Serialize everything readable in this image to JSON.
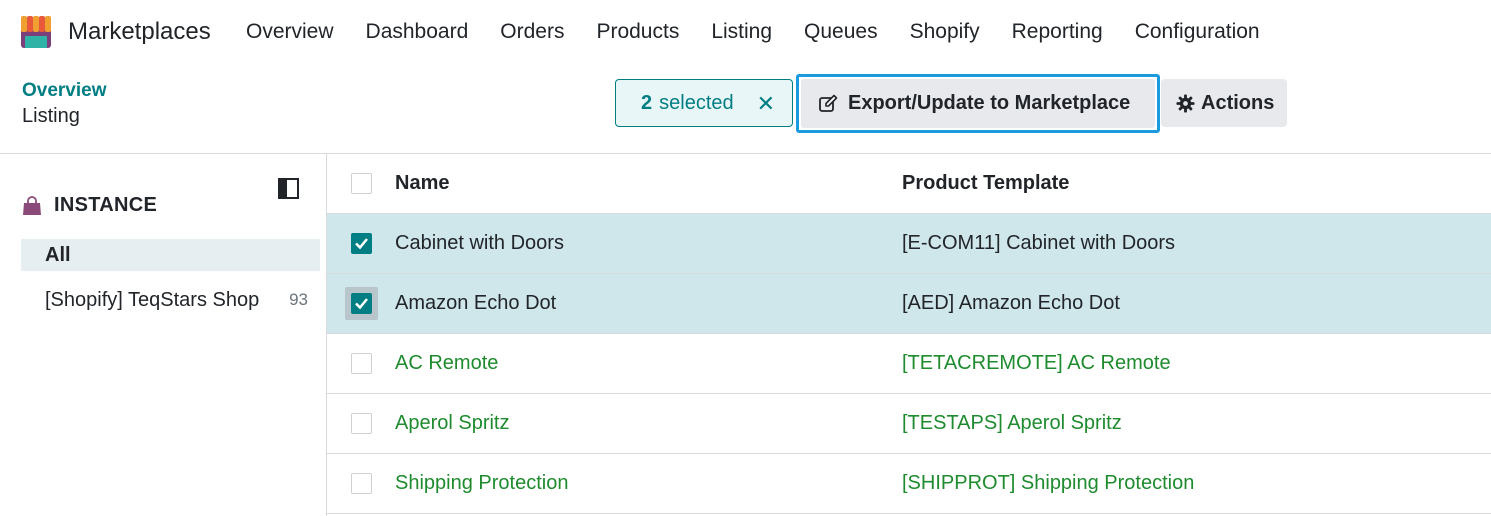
{
  "app": {
    "name": "Marketplaces",
    "logo_icon": "marketplace-shop-logo"
  },
  "menu": [
    "Overview",
    "Dashboard",
    "Orders",
    "Products",
    "Listing",
    "Queues",
    "Shopify",
    "Reporting",
    "Configuration"
  ],
  "breadcrumb": {
    "parent": "Overview",
    "current": "Listing"
  },
  "selection": {
    "count": "2",
    "label": "selected",
    "clear_icon": "close-icon"
  },
  "toolbar": {
    "export_label": "Export/Update to Marketplace",
    "export_icon": "edit-icon",
    "actions_label": "Actions",
    "actions_icon": "gear-icon"
  },
  "sidebar": {
    "title": "INSTANCE",
    "title_icon": "shopping-bag-icon",
    "filters": [
      {
        "label": "All",
        "active": true
      },
      {
        "label": "[Shopify] TeqStars Shop",
        "count": "93"
      }
    ]
  },
  "table": {
    "columns": [
      "Name",
      "Product Template"
    ],
    "rows": [
      {
        "name": "Cabinet with Doors",
        "template": "[E-COM11] Cabinet with Doors",
        "selected": true
      },
      {
        "name": "Amazon Echo Dot",
        "template": "[AED] Amazon Echo Dot",
        "selected": true
      },
      {
        "name": "AC Remote",
        "template": "[TETACREMOTE] AC Remote",
        "selected": false
      },
      {
        "name": "Aperol Spritz",
        "template": "[TESTAPS] Aperol Spritz",
        "selected": false
      },
      {
        "name": "Shipping Protection",
        "template": "[SHIPPROT] Shipping Protection",
        "selected": false
      }
    ]
  },
  "colors": {
    "accent": "#017e84",
    "link_green": "#1e8b2e",
    "selected_row": "#cfe7eb",
    "focus_border": "#1a9be0"
  }
}
